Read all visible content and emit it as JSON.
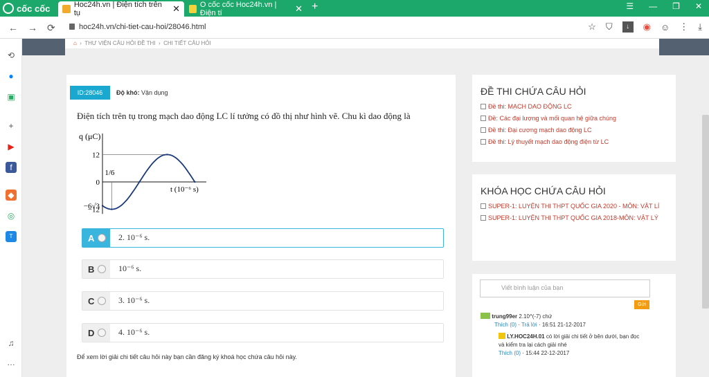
{
  "browser": {
    "brand": "cốc cốc",
    "tabs": [
      {
        "label": "Hoc24h.vn | Điện tích trên tụ"
      },
      {
        "label": "O cốc cốc Hoc24h.vn | Điện tí"
      }
    ],
    "new_tab": "+",
    "url": "hoc24h.vn/chi-tiet-cau-hoi/28046.html"
  },
  "breadcrumb": [
    "THƯ VIỆN CÂU HỎI ĐỀ THI",
    "CHI TIẾT CÂU HỎI"
  ],
  "question": {
    "id": "ID:28046",
    "difficulty_label": "Độ khó:",
    "difficulty_value": "Vận dụng",
    "text": "Điện tích trên tụ trong mạch dao động LC lí tưởng có đồ thị như hình vẽ. Chu kì dao động là"
  },
  "chart_data": {
    "type": "line",
    "title": "",
    "ylabel": "q (μC)",
    "xlabel": "t (10⁻⁶ s)",
    "y_ticks": [
      "12",
      "0",
      "−6√3",
      "−12"
    ],
    "x_marks": [
      "1/6"
    ],
    "ylim": [
      -12,
      12
    ],
    "series": [
      {
        "points": [
          {
            "x": 0,
            "y": -10.39
          },
          {
            "x": 0.1667,
            "y": -12
          },
          {
            "x": 0.6667,
            "y": 0
          },
          {
            "x": 1.1667,
            "y": 12
          },
          {
            "x": 1.6667,
            "y": 0
          }
        ]
      }
    ]
  },
  "options": [
    {
      "letter": "A",
      "text": "2. 10⁻⁶ s.",
      "selected": true
    },
    {
      "letter": "B",
      "text": "10⁻⁶ s.",
      "selected": false
    },
    {
      "letter": "C",
      "text": "3. 10⁻⁶ s.",
      "selected": false
    },
    {
      "letter": "D",
      "text": "4. 10⁻⁶ s.",
      "selected": false
    }
  ],
  "footnote": "Để xem lời giải chi tiết câu hỏi này bạn cần đăng ký khoá học chứa câu hỏi này.",
  "exams": {
    "heading": "ĐỀ THI CHỨA CÂU HỎI",
    "items": [
      "Đề thi: MẠCH DAO ĐỘNG LC",
      "Đề: Các đại lượng và mối quan hệ giữa chúng",
      "Đề thi: Đại cương mạch dao động LC",
      "Đề thi: Lý thuyết mạch dao động điện từ LC"
    ]
  },
  "courses": {
    "heading": "KHÓA HỌC CHỨA CÂU HỎI",
    "items": [
      "SUPER-1: LUYỆN THI THPT QUỐC GIA 2020 - MÔN: VẬT LÍ",
      "SUPER-1: LUYỆN THI THPT QUỐC GIA 2018-MÔN: VẬT LÝ"
    ]
  },
  "comments": {
    "placeholder": "Viết bình luận của bạn",
    "send": "Gửi",
    "c1_user": "trung99er",
    "c1_text": "2.10^(-7) chứ",
    "c1_like": "Thích (0)",
    "c1_reply": "Trả lời",
    "c1_time": "16:51 21-12-2017",
    "c2_user": "LY.HOC24H.01",
    "c2_text": "có lời giải chi tiết ở bên dưới, bạn đọc và kiểm tra lại cách giải nhé",
    "c2_like": "Thích (0)",
    "c2_time": "15:44 22-12-2017"
  }
}
